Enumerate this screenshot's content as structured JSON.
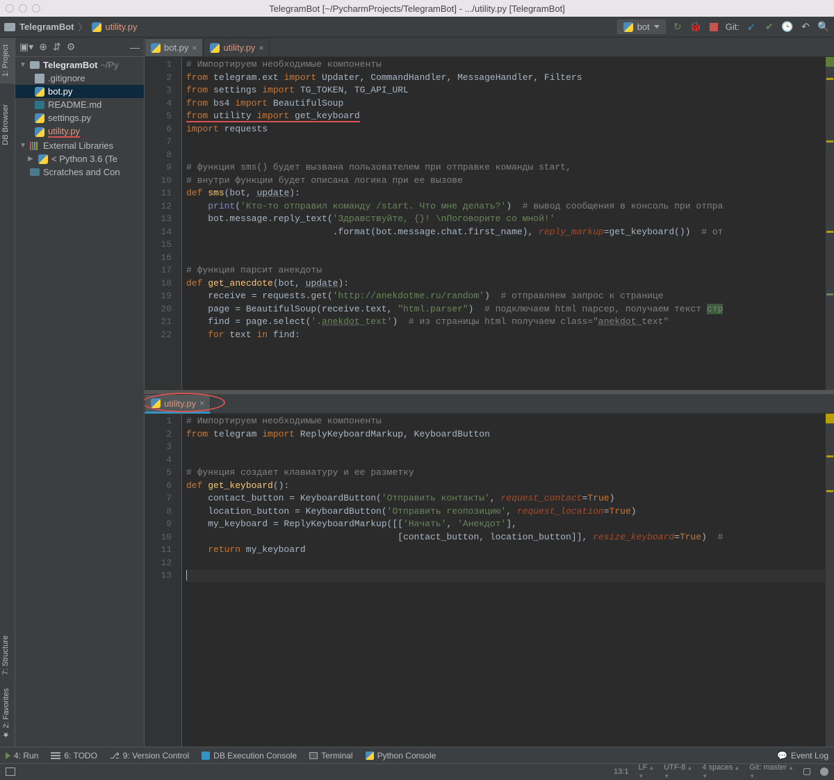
{
  "titlebar": {
    "text": "TelegramBot [~/PycharmProjects/TelegramBot] - .../utility.py [TelegramBot]"
  },
  "breadcrumb": {
    "root": "TelegramBot",
    "file": "utility.py"
  },
  "runConfig": {
    "label": "bot"
  },
  "gitLabel": "Git:",
  "leftRail": {
    "project": "1: Project",
    "db": "DB Browser",
    "structure": "7: Structure",
    "favorites": "2: Favorites"
  },
  "tree": {
    "root": "TelegramBot",
    "rootPath": "~/Py",
    "gitignore": ".gitignore",
    "bot": "bot.py",
    "readme": "README.md",
    "settings": "settings.py",
    "utility": "utility.py",
    "extlib": "External Libraries",
    "python": "< Python 3.6 (Te",
    "scratches": "Scratches and Con"
  },
  "tabsTop": {
    "bot": "bot.py",
    "utility": "utility.py"
  },
  "tabsBottom": {
    "utility": "utility.py"
  },
  "code1": {
    "lines": [
      "1",
      "2",
      "3",
      "4",
      "5",
      "6",
      "7",
      "8",
      "9",
      "10",
      "11",
      "12",
      "13",
      "14",
      "15",
      "16",
      "17",
      "18",
      "19",
      "20",
      "21",
      "22"
    ],
    "l1": "# Импортируем необходимые компоненты",
    "l2a": "from",
    "l2b": " telegram.ext ",
    "l2c": "import",
    "l2d": " Updater, CommandHandler, MessageHandler, Filters",
    "l3a": "from",
    "l3b": " settings ",
    "l3c": "import",
    "l3d": " TG_TOKEN, TG_API_URL",
    "l4a": "from",
    "l4b": " bs4 ",
    "l4c": "import",
    "l4d": " BeautifulSoup",
    "l5a": "from",
    "l5b": " utility ",
    "l5c": "import",
    "l5d": " get_keyboard",
    "l6a": "import",
    "l6b": " requests",
    "l9": "# функция sms() будет вызвана пользователем при отправке команды start,",
    "l10": "# внутри функции будет описана логика при ее вызове",
    "l11a": "def ",
    "l11b": "sms",
    "l11c": "(bot, ",
    "l11d": "update",
    "l11e": "):",
    "l12a": "    ",
    "l12b": "print",
    "l12c": "(",
    "l12d": "'Кто-то отправил команду /start. Что мне делать?'",
    "l12e": ")  ",
    "l12f": "# вывод сообщения в консоль при отпра",
    "l13a": "    bot.message.reply_text(",
    "l13b": "'Здравствуйте, {}! \\nПоговорите со мной!'",
    "l14a": "                           .format(bot.message.chat.first_name), ",
    "l14b": "reply_markup",
    "l14c": "=get_keyboard())  ",
    "l14d": "# от",
    "l17": "# функция парсит анекдоты",
    "l18a": "def ",
    "l18b": "get_anecdote",
    "l18c": "(bot, ",
    "l18d": "update",
    "l18e": "):",
    "l19a": "    receive = requests.get(",
    "l19b": "'http://anekdotme.ru/random'",
    "l19c": ")  ",
    "l19d": "# отправляем запрос к странице",
    "l20a": "    page = BeautifulSoup(receive.text, ",
    "l20b": "\"html.parser\"",
    "l20c": ")  ",
    "l20d": "# подключаем html парсер, получаем текст ",
    "l20e": "стр",
    "l21a": "    find = page.select(",
    "l21b": "'.",
    "l21c": "anekdot",
    "l21d": "_text'",
    "l21e": ")  ",
    "l21f": "# из страницы html получаем class=\"",
    "l21g": "anekdot",
    "l21h": "_text\"",
    "l22a": "    ",
    "l22b": "for ",
    "l22c": "text ",
    "l22d": "in ",
    "l22e": "find:"
  },
  "code2": {
    "lines": [
      "1",
      "2",
      "3",
      "4",
      "5",
      "6",
      "7",
      "8",
      "9",
      "10",
      "11",
      "12",
      "13"
    ],
    "l1": "# Импортируем необходимые компоненты",
    "l2a": "from",
    "l2b": " telegram ",
    "l2c": "import",
    "l2d": " ReplyKeyboardMarkup, KeyboardButton",
    "l5": "# функция создает клавиатуру и ее разметку",
    "l6a": "def ",
    "l6b": "get_keyboard",
    "l6c": "():",
    "l7a": "    contact_button = KeyboardButton(",
    "l7b": "'Отправить контакты'",
    "l7c": ", ",
    "l7d": "request_contact",
    "l7e": "=",
    "l7f": "True",
    "l7g": ")",
    "l8a": "    location_button = KeyboardButton(",
    "l8b": "'Отправить геопозицию'",
    "l8c": ", ",
    "l8d": "request_location",
    "l8e": "=",
    "l8f": "True",
    "l8g": ")",
    "l9a": "    my_keyboard = ReplyKeyboardMarkup([[",
    "l9b": "'Начать'",
    "l9c": ", ",
    "l9d": "'Анекдот'",
    "l9e": "],",
    "l10a": "                                       [contact_button, location_button]], ",
    "l10b": "resize_keyboard",
    "l10c": "=",
    "l10d": "True",
    "l10e": ")  ",
    "l10f": "#",
    "l11a": "    ",
    "l11b": "return ",
    "l11c": "my_keyboard"
  },
  "bottomTools": {
    "run": "4: Run",
    "todo": "6: TODO",
    "vc": "9: Version Control",
    "db": "DB Execution Console",
    "term": "Terminal",
    "pycon": "Python Console",
    "evlog": "Event Log"
  },
  "status": {
    "pos": "13:1",
    "lf": "LF",
    "enc": "UTF-8",
    "indent": "4 spaces",
    "git": "Git: master"
  }
}
